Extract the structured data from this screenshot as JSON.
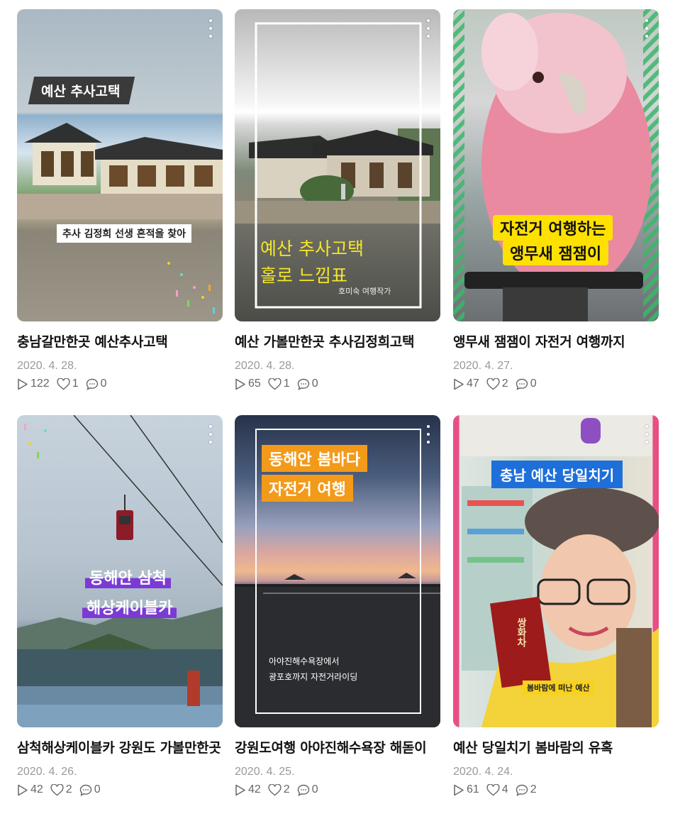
{
  "cards": [
    {
      "title": "충남갈만한곳 예산추사고택",
      "date": "2020. 4. 28.",
      "views": "122",
      "likes": "1",
      "comments": "0",
      "overlay": [
        "예산 추사고택",
        "추사 김정희 선생 흔적을 찾아"
      ]
    },
    {
      "title": "예산 가볼만한곳 추사김정희고택",
      "date": "2020. 4. 28.",
      "views": "65",
      "likes": "1",
      "comments": "0",
      "overlay": [
        "예산 추사고택",
        "홀로 느낌표",
        "호미숙 여행작가"
      ]
    },
    {
      "title": "앵무새 잼잼이 자전거 여행까지",
      "date": "2020. 4. 27.",
      "views": "47",
      "likes": "2",
      "comments": "0",
      "overlay": [
        "자전거 여행하는",
        "앵무새 잼잼이"
      ]
    },
    {
      "title": "삼척해상케이블카 강원도 가볼만한곳",
      "date": "2020. 4. 26.",
      "views": "42",
      "likes": "2",
      "comments": "0",
      "overlay": [
        "동해안 삼척",
        "해상케이블카"
      ]
    },
    {
      "title": "강원도여행 아야진해수욕장 해돋이",
      "date": "2020. 4. 25.",
      "views": "42",
      "likes": "2",
      "comments": "0",
      "overlay": [
        "동해안 봄바다",
        "자전거 여행",
        "아야진해수욕장에서",
        "광포호까지 자전거라이딩"
      ]
    },
    {
      "title": "예산 당일치기 봄바람의 유혹",
      "date": "2020. 4. 24.",
      "views": "61",
      "likes": "4",
      "comments": "2",
      "overlay": [
        "충남 예산 당일치기",
        "봄바람에 떠난 예산",
        "쌍화차"
      ]
    }
  ],
  "icons": {
    "views": "play-icon",
    "likes": "heart-icon",
    "comments": "comment-icon",
    "more": "more-vertical-icon"
  }
}
